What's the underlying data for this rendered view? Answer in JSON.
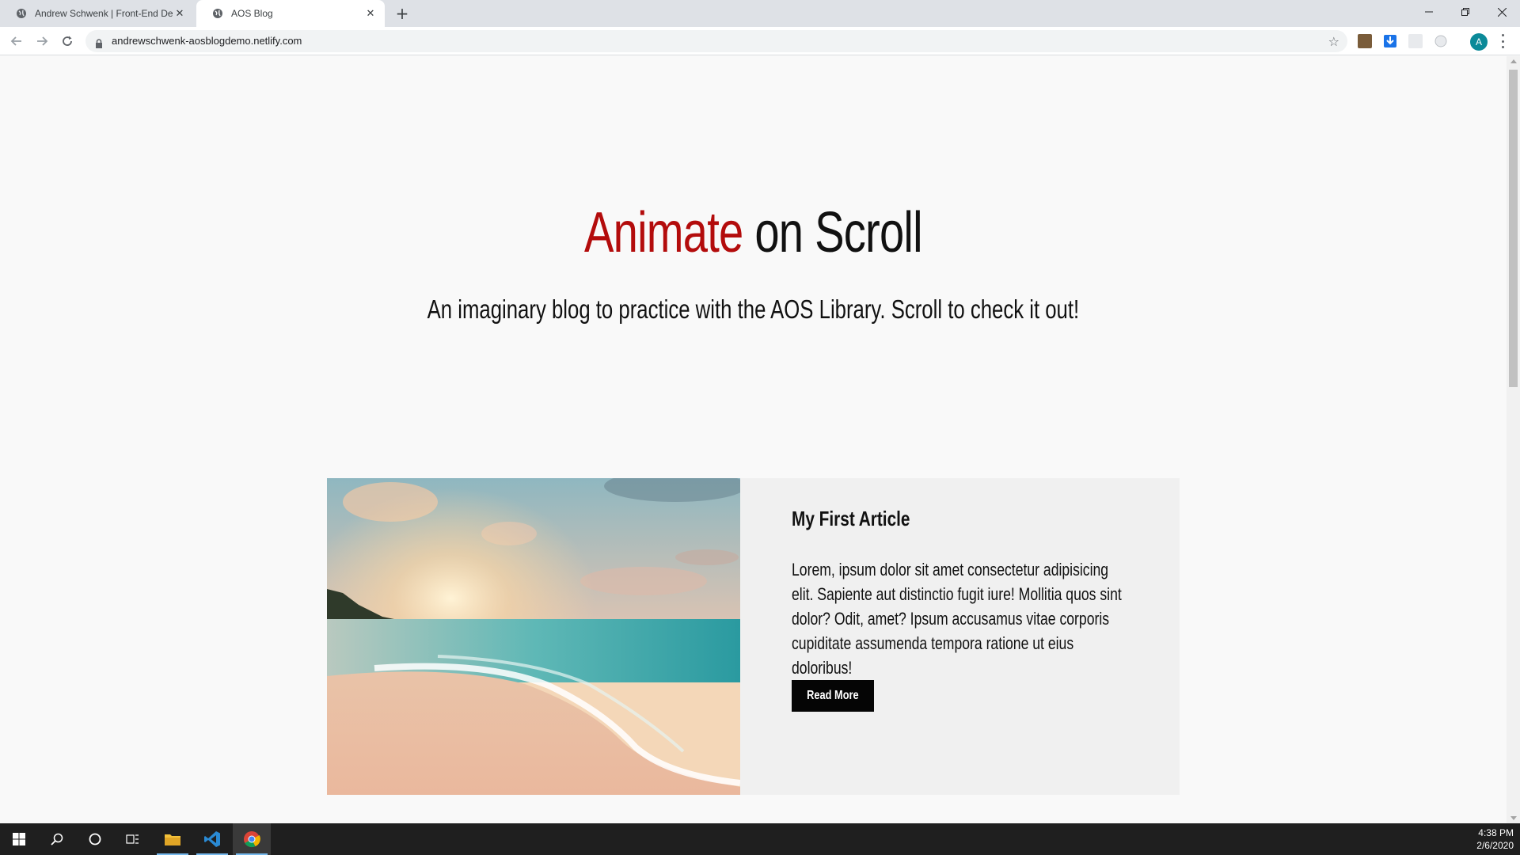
{
  "browser": {
    "tabs": [
      {
        "title": "Andrew Schwenk | Front-End De",
        "active": false
      },
      {
        "title": "AOS Blog",
        "active": true
      }
    ],
    "url": "andrewschwenk-aosblogdemo.netlify.com",
    "profile_initial": "A"
  },
  "hero": {
    "title_accent": "Animate",
    "title_rest": " on Scroll",
    "subtitle": "An imaginary blog to practice with the AOS Library. Scroll to check it out!"
  },
  "article": {
    "title": "My First Article",
    "body": "Lorem, ipsum dolor sit amet consectetur adipisicing elit. Sapiente aut distinctio fugit iure! Mollitia quos sint dolor? Odit, amet? Ipsum accusamus vitae corporis cupiditate assumenda tempora ratione ut eius doloribus!",
    "button_label": "Read More",
    "image": "beach-sunset"
  },
  "taskbar": {
    "time": "4:38 PM",
    "date": "2/6/2020"
  },
  "colors": {
    "accent": "#b30c0c",
    "tab_strip": "#dee1e6",
    "taskbar": "#1f1f1f"
  }
}
